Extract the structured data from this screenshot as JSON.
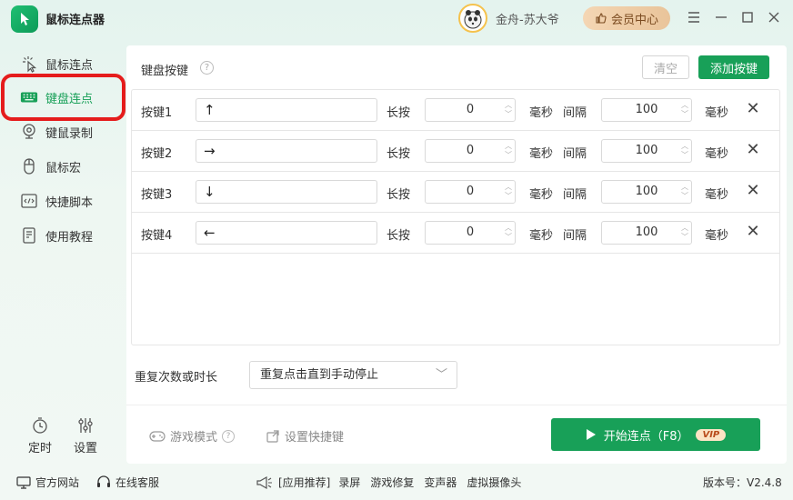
{
  "app": {
    "title": "鼠标连点器"
  },
  "user": {
    "name": "金舟-苏大爷"
  },
  "header": {
    "vip_center": "会员中心"
  },
  "sidebar": {
    "items": [
      {
        "label": "鼠标连点",
        "icon": "mouse-click-icon"
      },
      {
        "label": "键盘连点",
        "icon": "keyboard-icon"
      },
      {
        "label": "键鼠录制",
        "icon": "camera-icon"
      },
      {
        "label": "鼠标宏",
        "icon": "mouse-icon"
      },
      {
        "label": "快捷脚本",
        "icon": "code-icon"
      },
      {
        "label": "使用教程",
        "icon": "tutorial-icon"
      }
    ],
    "active_index": 1,
    "bottom": {
      "timer": "定时",
      "settings": "设置"
    }
  },
  "main": {
    "section_title": "键盘按键",
    "clear_label": "清空",
    "add_label": "添加按键",
    "columns": {
      "long_press": "长按",
      "ms": "毫秒",
      "interval": "间隔"
    },
    "rows": [
      {
        "label": "按键1",
        "key": "↑",
        "press": "0",
        "interval": "100"
      },
      {
        "label": "按键2",
        "key": "→",
        "press": "0",
        "interval": "100"
      },
      {
        "label": "按键3",
        "key": "↓",
        "press": "0",
        "interval": "100"
      },
      {
        "label": "按键4",
        "key": "←",
        "press": "0",
        "interval": "100"
      }
    ],
    "repeat_label": "重复次数或时长",
    "repeat_value": "重复点击直到手动停止",
    "game_mode": "游戏模式",
    "hotkey": "设置快捷键",
    "start_label": "开始连点（F8）",
    "vip_badge": "VIP"
  },
  "statusbar": {
    "website": "官方网站",
    "support": "在线客服",
    "recommend": "[应用推荐]",
    "links": [
      "录屏",
      "游戏修复",
      "变声器",
      "虚拟摄像头"
    ],
    "version": "版本号：V2.4.8"
  },
  "colors": {
    "accent": "#18a058",
    "highlight": "#e51c1c",
    "vip_bg": "#e9c49a"
  }
}
